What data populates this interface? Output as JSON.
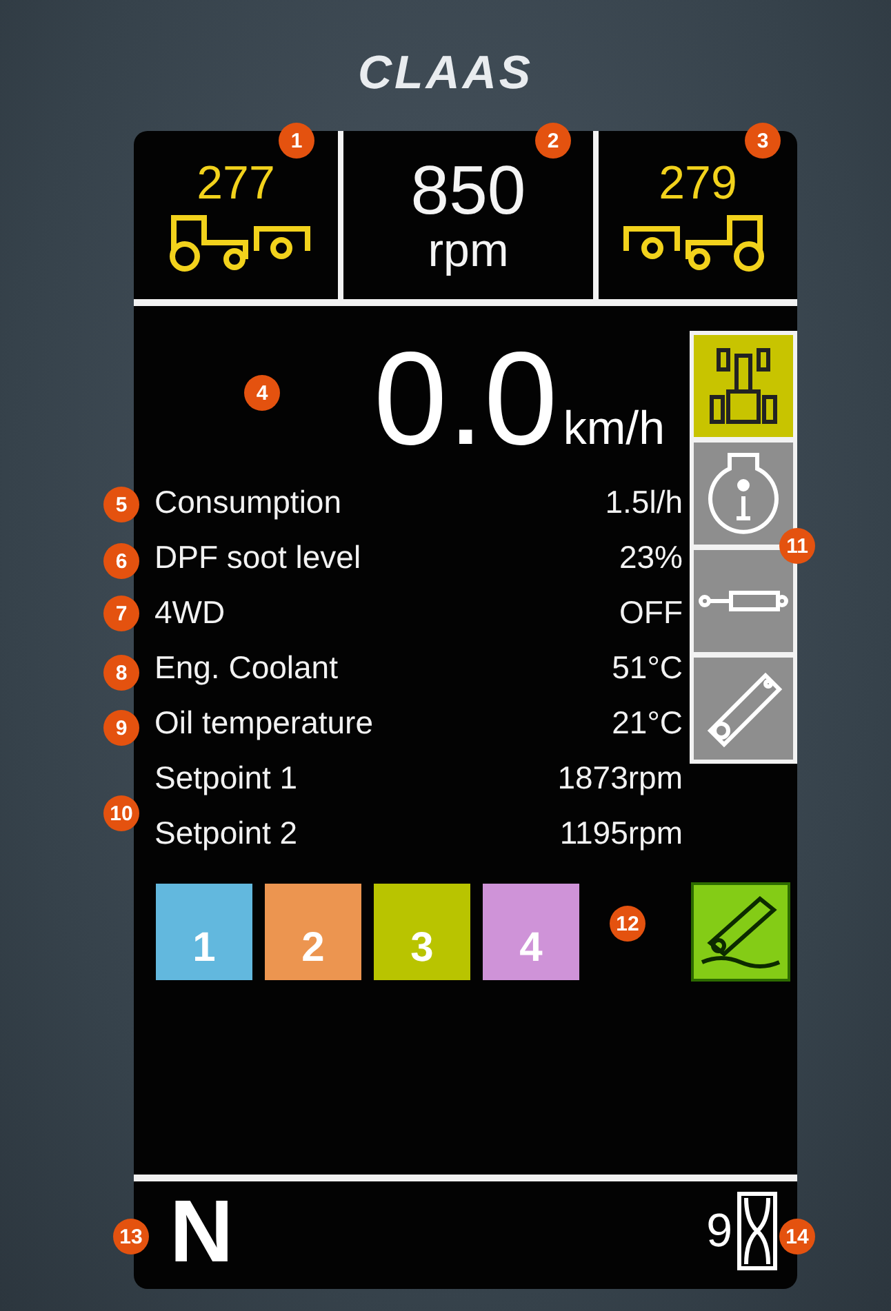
{
  "brand": "CLAAS",
  "top_bar": [
    {
      "kind": "rear-pto",
      "value": "277"
    },
    {
      "kind": "engine",
      "value": "850",
      "unit": "rpm"
    },
    {
      "kind": "front-pto",
      "value": "279"
    }
  ],
  "speed": {
    "value": "0.0",
    "unit": "km/h"
  },
  "readings": [
    {
      "label": "Consumption",
      "value": "1.5l/h"
    },
    {
      "label": "DPF soot level",
      "value": "23%"
    },
    {
      "label": "4WD",
      "value": "OFF"
    },
    {
      "label": "Eng. Coolant",
      "value": "51°C"
    },
    {
      "label": "Oil temperature",
      "value": "21°C"
    },
    {
      "label": "Setpoint 1",
      "value": "1873rpm"
    },
    {
      "label": "Setpoint 2",
      "value": "1195rpm"
    }
  ],
  "side_buttons": [
    {
      "kind": "tractor",
      "selected": true
    },
    {
      "kind": "info",
      "selected": false
    },
    {
      "kind": "cylinder",
      "selected": false
    },
    {
      "kind": "arm",
      "selected": false
    }
  ],
  "memory_keys": [
    {
      "label": "1",
      "color": "#62b8de"
    },
    {
      "label": "2",
      "color": "#ec9550"
    },
    {
      "label": "3",
      "color": "#b9c400"
    },
    {
      "label": "4",
      "color": "#cf93d8"
    }
  ],
  "linkage_button": {
    "kind": "arm-ground"
  },
  "gear": "N",
  "timer": "9",
  "callouts": [
    "1",
    "2",
    "3",
    "4",
    "5",
    "6",
    "7",
    "8",
    "9",
    "10",
    "11",
    "12",
    "13",
    "14"
  ]
}
